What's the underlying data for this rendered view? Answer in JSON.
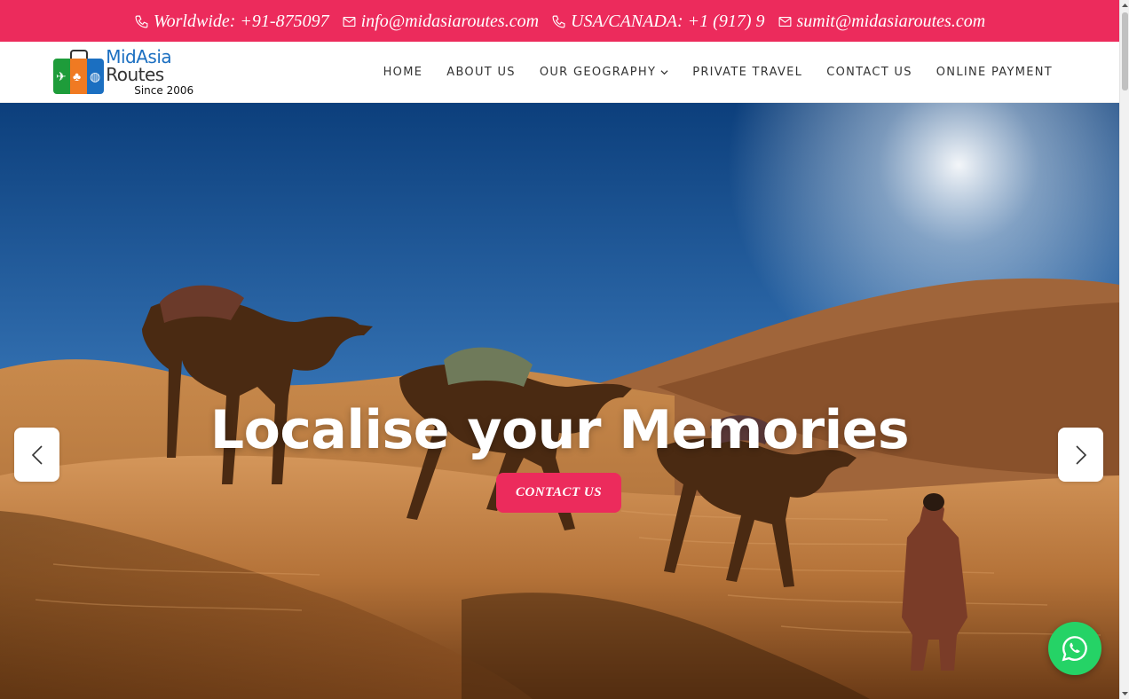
{
  "topbar": {
    "items": [
      {
        "icon": "phone-icon",
        "text": "Worldwide: +91-875097"
      },
      {
        "icon": "mail-icon",
        "text": "info@midasiaroutes.com"
      },
      {
        "icon": "phone-icon",
        "text": "USA/CANADA: +1 (917) 9"
      },
      {
        "icon": "mail-icon",
        "text": "sumit@midasiaroutes.com"
      }
    ],
    "background": "#ec2b5c"
  },
  "logo": {
    "name_part1": "MidAsia",
    "name_part2": "Routes",
    "tagline": "Since 2006"
  },
  "nav": {
    "items": [
      {
        "label": "HOME"
      },
      {
        "label": "ABOUT US"
      },
      {
        "label": "OUR GEOGRAPHY",
        "has_dropdown": true
      },
      {
        "label": "PRIVATE TRAVEL"
      },
      {
        "label": "CONTACT US"
      },
      {
        "label": "ONLINE PAYMENT"
      }
    ]
  },
  "hero": {
    "title": "Localise your Memories",
    "cta_label": "CONTACT US",
    "accent": "#ec2b5c"
  },
  "floating": {
    "whatsapp_icon": "whatsapp-icon",
    "color": "#25d366"
  }
}
